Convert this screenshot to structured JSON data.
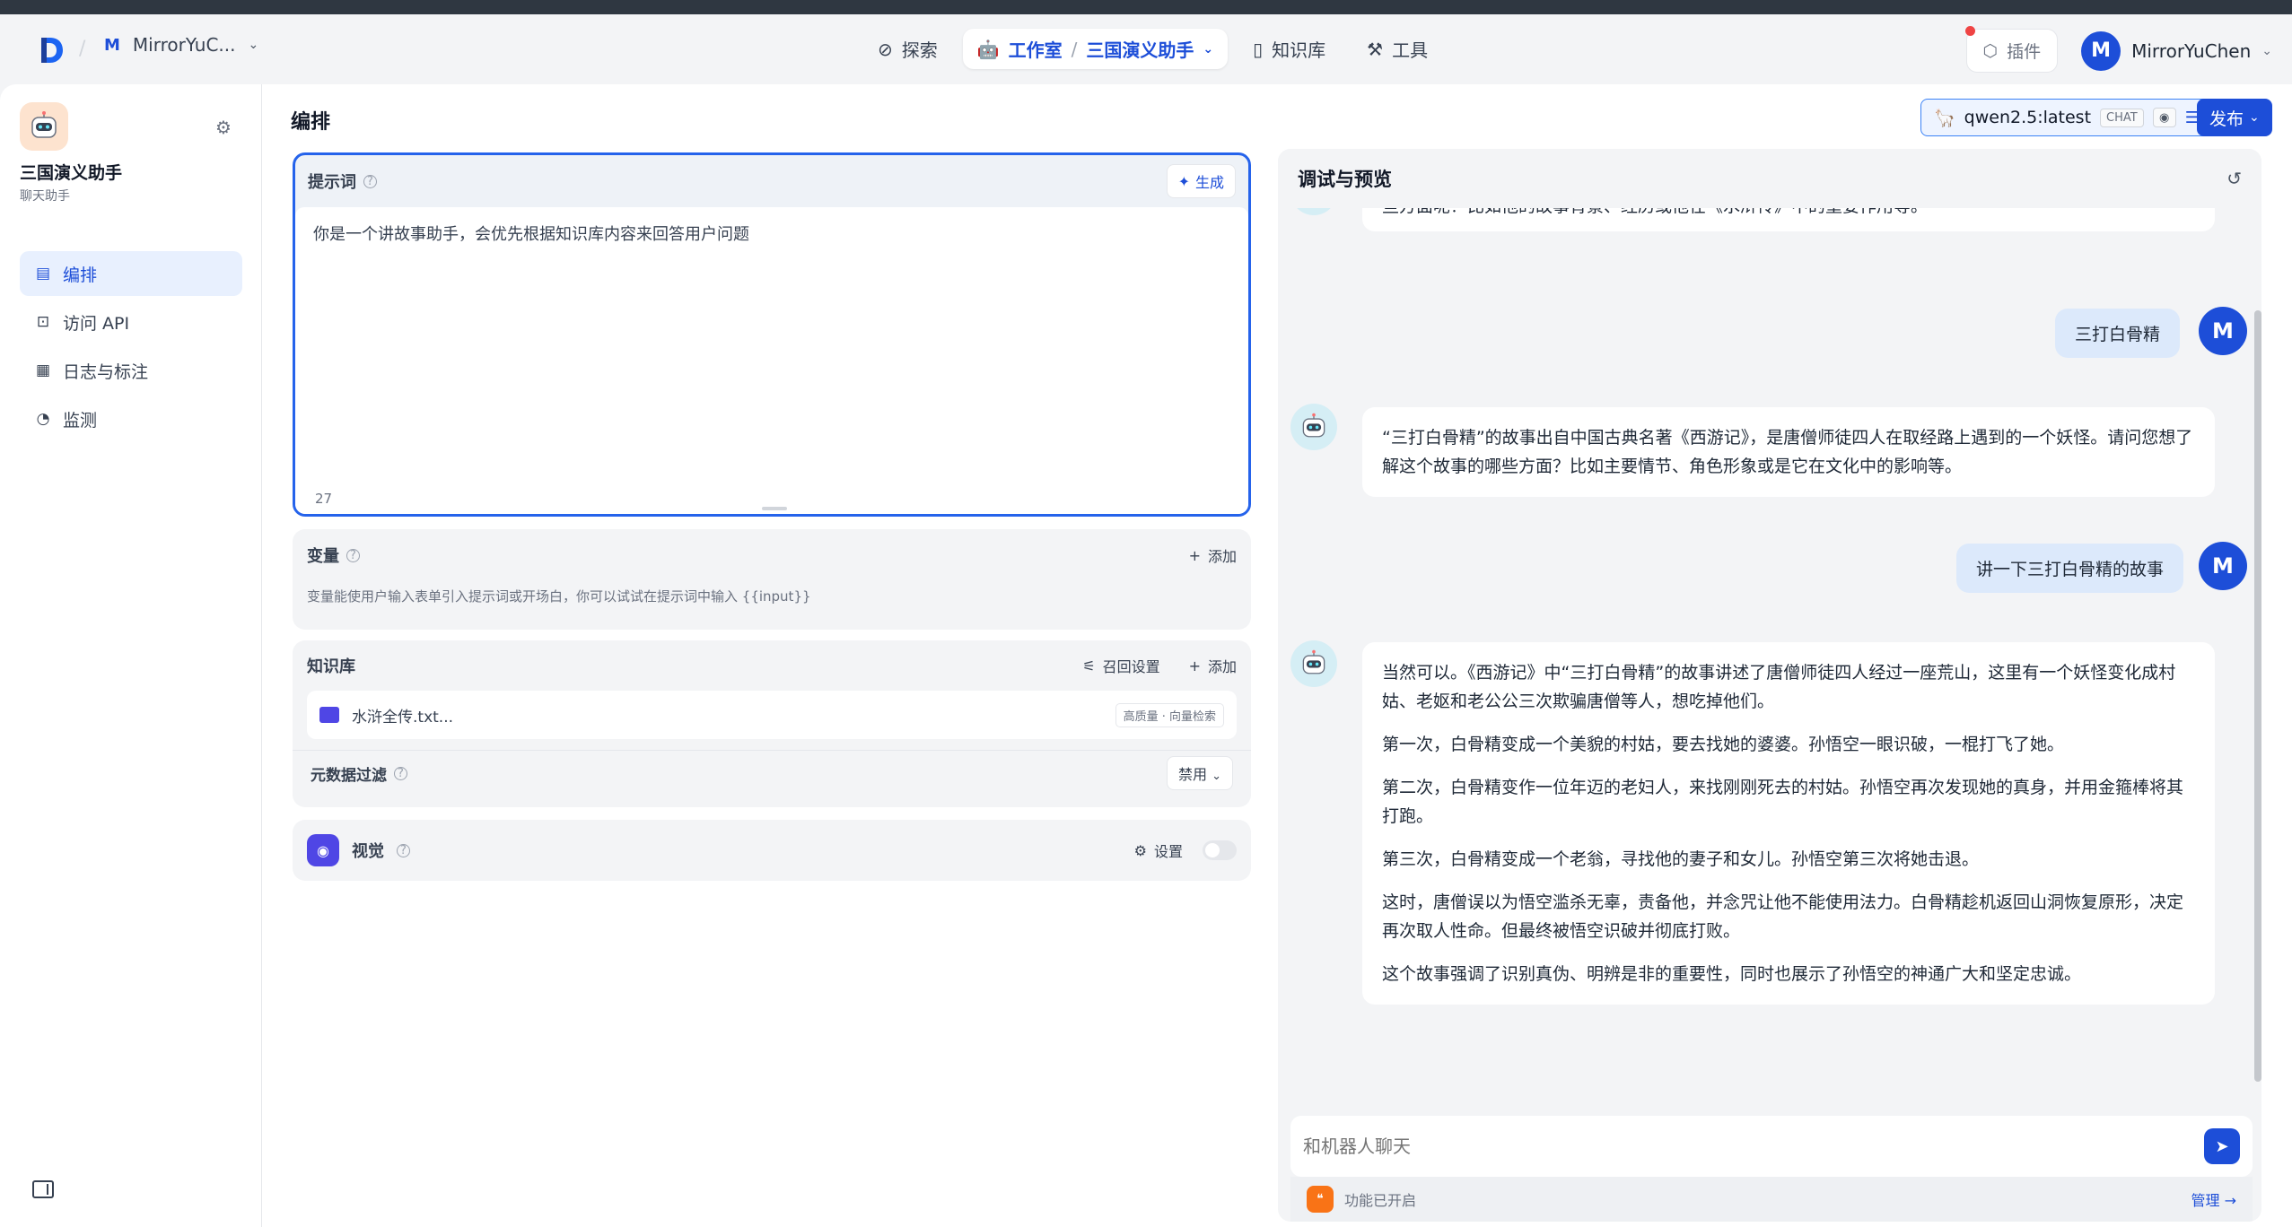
{
  "header": {
    "workspace_initial": "M",
    "workspace_name": "MirrorYuC...",
    "nav": {
      "explore": "探索",
      "studio": "工作室",
      "current_app": "三国演义助手",
      "knowledge": "知识库",
      "tools": "工具"
    },
    "plugin_label": "插件",
    "user_initial": "M",
    "user_name": "MirrorYuChen"
  },
  "sidebar": {
    "app_name": "三国演义助手",
    "app_type": "聊天助手",
    "items": [
      {
        "label": "编排",
        "icon": "layout-icon"
      },
      {
        "label": "访问 API",
        "icon": "terminal-icon"
      },
      {
        "label": "日志与标注",
        "icon": "file-list-icon"
      },
      {
        "label": "监测",
        "icon": "gauge-icon"
      }
    ]
  },
  "main": {
    "title": "编排",
    "model": {
      "name": "qwen2.5:latest",
      "mode": "CHAT"
    },
    "publish_label": "发布",
    "prompt": {
      "title": "提示词",
      "generate_label": "生成",
      "text": "你是一个讲故事助手，会优先根据知识库内容来回答用户问题",
      "char_count": "27"
    },
    "variables": {
      "title": "变量",
      "add_label": "添加",
      "description": "变量能使用户输入表单引入提示词或开场白，你可以试试在提示词中输入 {{input}}"
    },
    "knowledge": {
      "title": "知识库",
      "recall_label": "召回设置",
      "add_label": "添加",
      "file_name": "水浒全传.txt...",
      "file_tag": "高质量 · 向量检索",
      "metadata_filter_label": "元数据过滤",
      "metadata_filter_value": "禁用"
    },
    "vision": {
      "title": "视觉",
      "settings_label": "设置"
    }
  },
  "chat": {
    "title": "调试与预览",
    "messages": [
      {
        "role": "bot",
        "text": "些方面呢？比如他的故事背景、经历或他在《水浒传》中的重要作用等。"
      },
      {
        "role": "user",
        "text": "三打白骨精"
      },
      {
        "role": "bot",
        "text": "“三打白骨精”的故事出自中国古典名著《西游记》，是唐僧师徒四人在取经路上遇到的一个妖怪。请问您想了解这个故事的哪些方面？比如主要情节、角色形象或是它在文化中的影响等。"
      },
      {
        "role": "user",
        "text": "讲一下三打白骨精的故事"
      },
      {
        "role": "bot",
        "paragraphs": [
          "当然可以。《西游记》中“三打白骨精”的故事讲述了唐僧师徒四人经过一座荒山，这里有一个妖怪变化成村姑、老妪和老公公三次欺骗唐僧等人，想吃掉他们。",
          "第一次，白骨精变成一个美貌的村姑，要去找她的婆婆。孙悟空一眼识破，一棍打飞了她。",
          "第二次，白骨精变作一位年迈的老妇人，来找刚刚死去的村姑。孙悟空再次发现她的真身，并用金箍棒将其打跑。",
          "第三次，白骨精变成一个老翁，寻找他的妻子和女儿。孙悟空第三次将她击退。",
          "这时，唐僧误以为悟空滥杀无辜，责备他，并念咒让他不能使用法力。白骨精趁机返回山洞恢复原形，决定再次取人性命。但最终被悟空识破并彻底打败。",
          "这个故事强调了识别真伪、明辨是非的重要性，同时也展示了孙悟空的神通广大和坚定忠诚。"
        ]
      }
    ],
    "input_placeholder": "和机器人聊天",
    "feature_status": "功能已开启",
    "manage_label": "管理"
  }
}
